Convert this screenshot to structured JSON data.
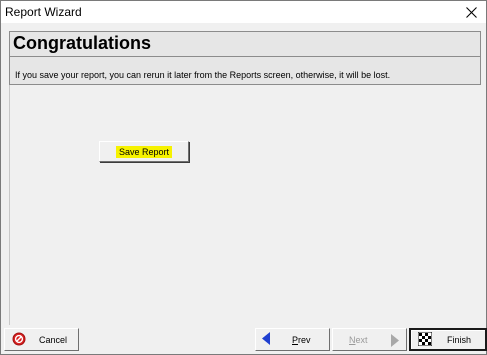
{
  "window": {
    "title": "Report Wizard"
  },
  "header": {
    "title": "Congratulations",
    "description": "If you save your report, you can rerun it later from the Reports screen, otherwise, it will be lost."
  },
  "main": {
    "save_label": "Save Report"
  },
  "footer": {
    "cancel": {
      "label": "Cancel",
      "icon": "cancel-icon"
    },
    "prev": {
      "label_underlined": "P",
      "label_rest": "rev",
      "icon": "arrow-left-icon"
    },
    "next": {
      "label_underlined": "N",
      "label_rest": "ext",
      "icon": "arrow-right-icon",
      "enabled": false
    },
    "finish": {
      "label": "Finish",
      "icon": "checkered-flag-icon"
    }
  },
  "colors": {
    "highlight": "#f6f200",
    "cancel_red": "#d92020",
    "arrow_blue": "#1f3fd0"
  }
}
